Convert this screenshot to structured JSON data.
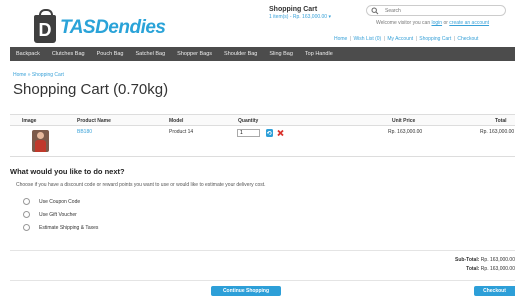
{
  "header": {
    "logo_letter": "D",
    "logo_text": "TASDendies",
    "cart_title": "Shopping Cart",
    "cart_summary": "1 item(s) - Rp. 163,000.00 ▾",
    "search_placeholder": "Search",
    "welcome_prefix": "Welcome visitor you can ",
    "login_label": "login",
    "welcome_or": " or ",
    "create_account_label": "create an account",
    "toplinks": [
      "Home",
      "Wish List (0)",
      "My Account",
      "Shopping Cart",
      "Checkout"
    ]
  },
  "menu": [
    "Backpack",
    "Clutches Bag",
    "Pouch Bag",
    "Satchel Bag",
    "Shopper Bags",
    "Shoulder Bag",
    "Sling Bag",
    "Top Handle"
  ],
  "breadcrumb": [
    "Home",
    "»",
    "Shopping Cart"
  ],
  "page_title": "Shopping Cart  (0.70kg)",
  "table": {
    "headers": {
      "image": "Image",
      "product_name": "Product Name",
      "model": "Model",
      "quantity": "Quantity",
      "unit_price": "Unit Price",
      "total": "Total"
    },
    "rows": [
      {
        "product_name": "BB180",
        "model": "Product 14",
        "quantity": "1",
        "unit_price": "Rp. 163,000.00",
        "total": "Rp. 163,000.00",
        "update_icon": "refresh-icon",
        "remove_icon": "remove-icon"
      }
    ]
  },
  "next": {
    "question": "What would you like to do next?",
    "instruction": "Choose if you have a discount code or reward points you want to use or would like to estimate your delivery cost.",
    "options": [
      "Use Coupon Code",
      "Use Gift Voucher",
      "Estimate Shipping & Taxes"
    ]
  },
  "totals": {
    "subtotal_label": "Sub-Total:",
    "subtotal_value": "Rp. 163,000.00",
    "total_label": "Total:",
    "total_value": "Rp. 163,000.00"
  },
  "buttons": {
    "continue": "Continue Shopping",
    "checkout": "Checkout"
  },
  "colors": {
    "accent": "#2d9fd8",
    "menu_bg": "#4c4c4c",
    "remove": "#d9312b"
  }
}
